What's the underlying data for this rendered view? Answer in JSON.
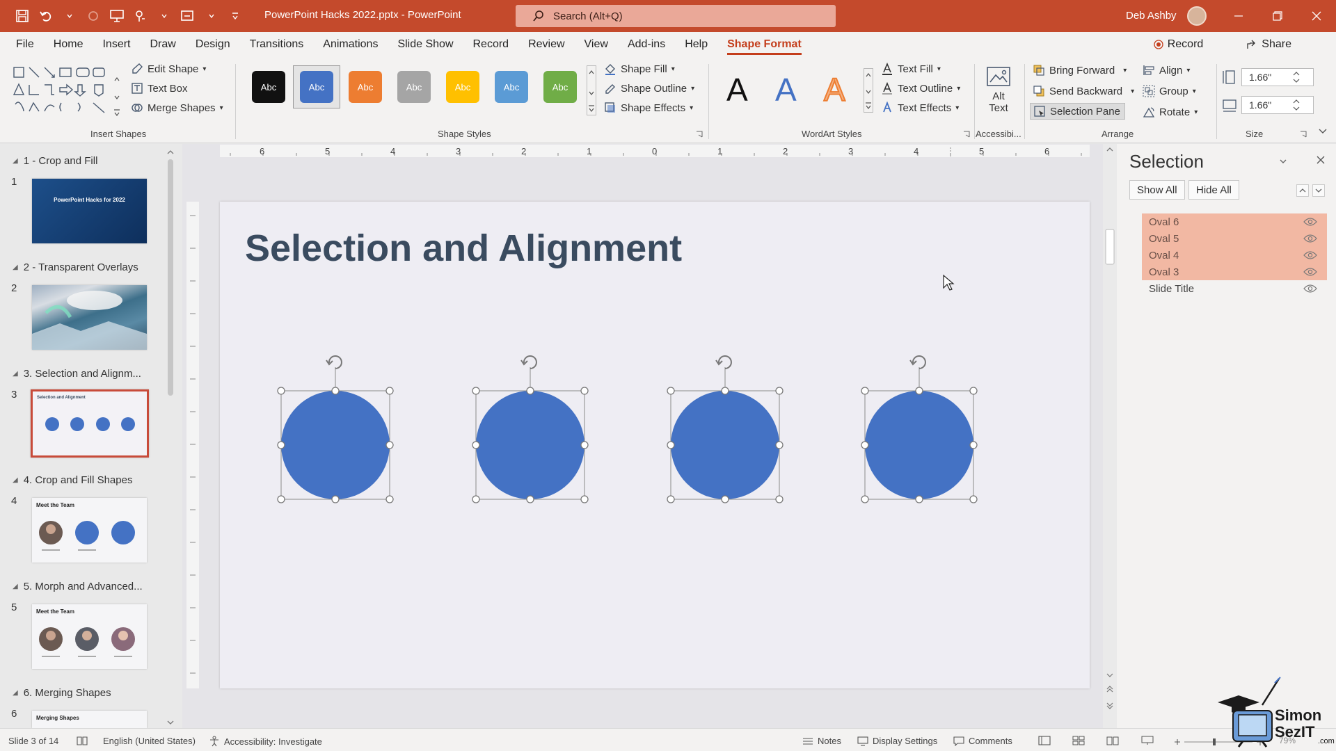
{
  "app": {
    "doc_title": "PowerPoint Hacks 2022.pptx - PowerPoint",
    "search_placeholder": "Search (Alt+Q)",
    "user_name": "Deb Ashby"
  },
  "menu": {
    "items": [
      "File",
      "Home",
      "Insert",
      "Draw",
      "Design",
      "Transitions",
      "Animations",
      "Slide Show",
      "Record",
      "Review",
      "View",
      "Add-ins",
      "Help"
    ],
    "active": "Shape Format",
    "record_label": "Record",
    "share_label": "Share"
  },
  "ribbon": {
    "insert_shapes": {
      "label": "Insert Shapes",
      "edit_shape": "Edit Shape",
      "text_box": "Text Box",
      "merge_shapes": "Merge Shapes"
    },
    "shape_styles": {
      "label": "Shape Styles",
      "swatch_text": "Abc",
      "swatch_colors": [
        "#111111",
        "#4472c4",
        "#ed7d31",
        "#a5a5a5",
        "#ffc000",
        "#5b9bd5",
        "#70ad47"
      ],
      "shape_fill": "Shape Fill",
      "shape_outline": "Shape Outline",
      "shape_effects": "Shape Effects"
    },
    "wordart": {
      "label": "WordArt Styles",
      "glyph": "A",
      "text_fill": "Text Fill",
      "text_outline": "Text Outline",
      "text_effects": "Text Effects"
    },
    "accessibility": {
      "label": "Accessibi...",
      "alt_text_1": "Alt",
      "alt_text_2": "Text"
    },
    "arrange": {
      "label": "Arrange",
      "bring_forward": "Bring Forward",
      "send_backward": "Send Backward",
      "selection_pane": "Selection Pane",
      "align": "Align",
      "group": "Group",
      "rotate": "Rotate"
    },
    "size": {
      "label": "Size",
      "height": "1.66\"",
      "width": "1.66\""
    }
  },
  "thumbnails": {
    "sections": [
      {
        "label": "1 - Crop and Fill",
        "slide": "1"
      },
      {
        "label": "2 - Transparent Overlays",
        "slide": "2"
      },
      {
        "label": "3. Selection and Alignm...",
        "slide": "3"
      },
      {
        "label": "4. Crop and Fill Shapes",
        "slide": "4"
      },
      {
        "label": "5. Morph and Advanced...",
        "slide": "5"
      },
      {
        "label": "6. Merging Shapes",
        "slide": "6"
      }
    ],
    "slide1_text": "PowerPoint Hacks for 2022",
    "slide3_text": "Selection and Alignment",
    "slide4_text": "Meet the Team",
    "slide5_text": "Meet the Team",
    "slide6_text": "Merging Shapes"
  },
  "ruler": {
    "labels": [
      "6",
      "5",
      "4",
      "3",
      "2",
      "1",
      "0",
      "1",
      "2",
      "3",
      "4",
      "5",
      "6"
    ]
  },
  "slide": {
    "title": "Selection and Alignment",
    "circle_color": "#4472c4"
  },
  "selection_pane": {
    "title": "Selection",
    "show_all": "Show All",
    "hide_all": "Hide All",
    "items": [
      {
        "name": "Oval 6",
        "selected": true
      },
      {
        "name": "Oval 5",
        "selected": true
      },
      {
        "name": "Oval 4",
        "selected": true
      },
      {
        "name": "Oval 3",
        "selected": true
      },
      {
        "name": "Slide Title",
        "selected": false
      }
    ]
  },
  "status": {
    "slide_info": "Slide 3 of 14",
    "language": "English (United States)",
    "accessibility": "Accessibility: Investigate",
    "notes": "Notes",
    "display_settings": "Display Settings",
    "comments": "Comments",
    "zoom": "79%"
  },
  "logo": {
    "line1": "Simon",
    "line2": "SezIT",
    "line3": ".com"
  }
}
